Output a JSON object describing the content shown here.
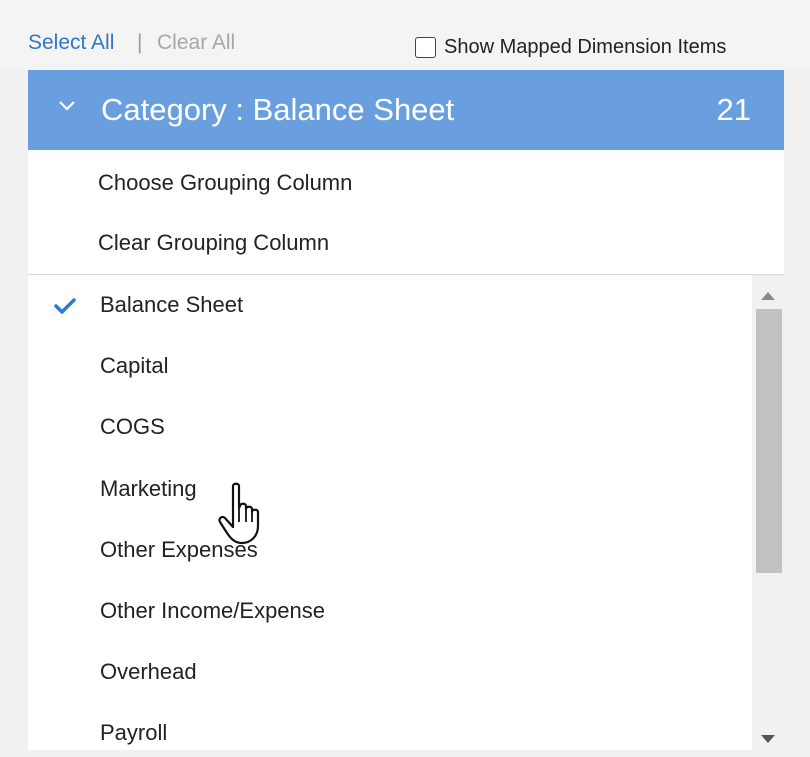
{
  "toolbar": {
    "select_all": "Select All",
    "separator": "|",
    "clear_all": "Clear All",
    "show_mapped_label": "Show Mapped Dimension Items",
    "show_mapped_checked": false
  },
  "group": {
    "title": "Category : Balance Sheet",
    "count": "21",
    "expanded": true
  },
  "grouping_menu": {
    "choose": "Choose Grouping Column",
    "clear": "Clear Grouping Column"
  },
  "items": [
    {
      "label": "Balance Sheet",
      "selected": true
    },
    {
      "label": "Capital",
      "selected": false
    },
    {
      "label": "COGS",
      "selected": false
    },
    {
      "label": "Marketing",
      "selected": false
    },
    {
      "label": "Other Expenses",
      "selected": false
    },
    {
      "label": "Other Income/Expense",
      "selected": false
    },
    {
      "label": "Overhead",
      "selected": false
    },
    {
      "label": "Payroll",
      "selected": false
    }
  ],
  "colors": {
    "header_bg": "#6a9fdf",
    "link": "#2f78c4",
    "check": "#2a7bd1"
  }
}
